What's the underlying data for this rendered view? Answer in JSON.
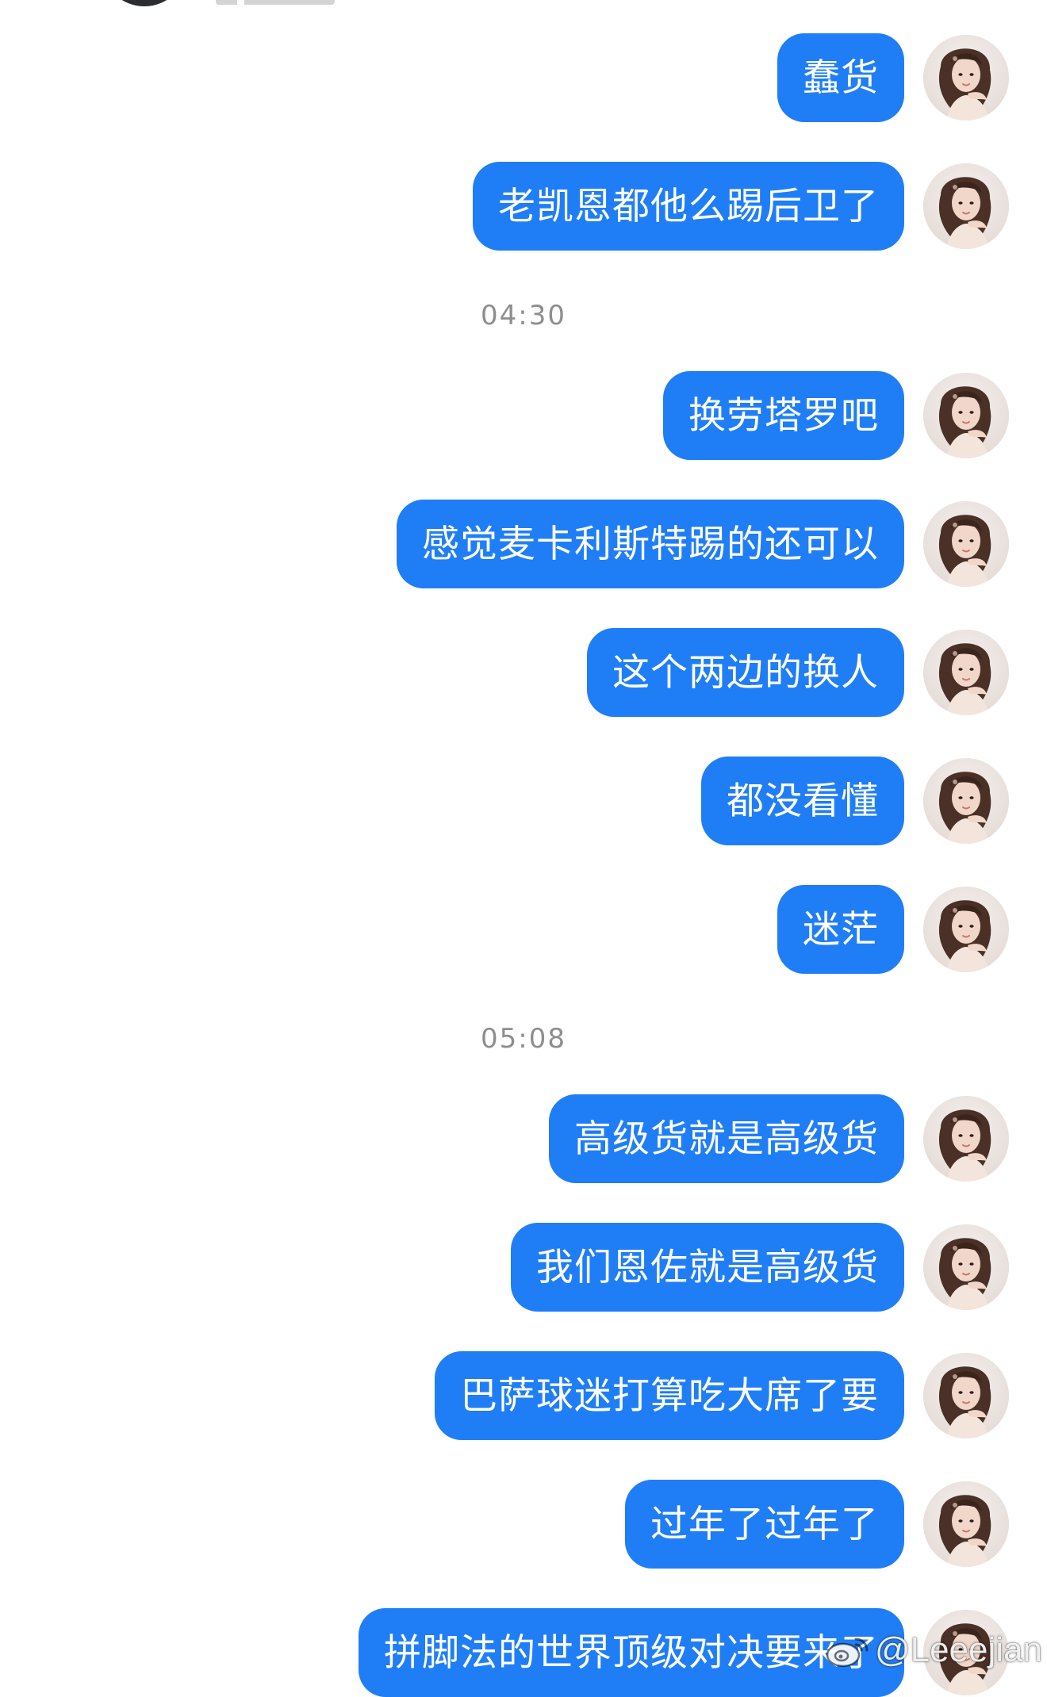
{
  "colors": {
    "bubble_bg": "#1f7ef6",
    "bubble_text": "#ffffff",
    "timestamp_text": "#8e8e8e",
    "background": "#ffffff"
  },
  "avatar_icon": "woman-portrait-avatar",
  "watermark": {
    "icon": "weibo-icon",
    "text": "@Leeejian"
  },
  "messages": [
    {
      "type": "sent",
      "text": "蠢货"
    },
    {
      "type": "sent",
      "text": "老凯恩都他么踢后卫了"
    },
    {
      "type": "time",
      "text": "04:30"
    },
    {
      "type": "sent",
      "text": "换劳塔罗吧"
    },
    {
      "type": "sent",
      "text": "感觉麦卡利斯特踢的还可以"
    },
    {
      "type": "sent",
      "text": "这个两边的换人"
    },
    {
      "type": "sent",
      "text": "都没看懂"
    },
    {
      "type": "sent",
      "text": "迷茫"
    },
    {
      "type": "time",
      "text": "05:08"
    },
    {
      "type": "sent",
      "text": "高级货就是高级货"
    },
    {
      "type": "sent",
      "text": "我们恩佐就是高级货"
    },
    {
      "type": "sent",
      "text": "巴萨球迷打算吃大席了要"
    },
    {
      "type": "sent",
      "text": "过年了过年了"
    },
    {
      "type": "sent",
      "text": "拼脚法的世界顶级对决要来了"
    }
  ]
}
